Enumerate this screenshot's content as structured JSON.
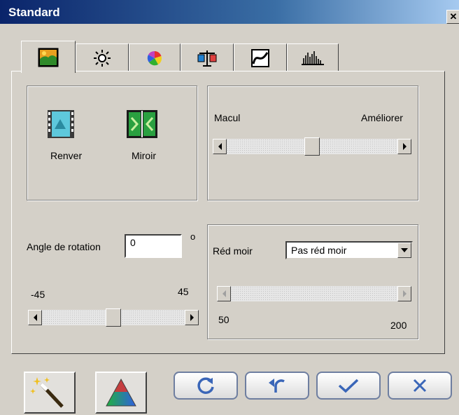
{
  "window": {
    "title": "Standard"
  },
  "tabs": [
    {
      "icon": "landscape-image-icon",
      "active": true
    },
    {
      "icon": "brightness-sun-icon",
      "active": false
    },
    {
      "icon": "color-wheel-icon",
      "active": false
    },
    {
      "icon": "color-balance-scale-icon",
      "active": false
    },
    {
      "icon": "tone-curve-icon",
      "active": false
    },
    {
      "icon": "histogram-icon",
      "active": false
    }
  ],
  "flip_group": {
    "flip_label": "Renver",
    "mirror_label": "Miroir"
  },
  "sharpen_group": {
    "left_label": "Macul",
    "right_label": "Améliorer",
    "level": 0.5
  },
  "rotation_group": {
    "label": "Angle de rotation",
    "value": "0",
    "unit": "o",
    "min_label": "-45",
    "max_label": "45",
    "level": 0.5
  },
  "moire_group": {
    "label": "Réd moir",
    "selected": "Pas réd moir",
    "min_label": "50",
    "max_label": "200"
  },
  "colors": {
    "titlebar": "#0a246a",
    "dialog_bg": "#d4d0c8"
  }
}
